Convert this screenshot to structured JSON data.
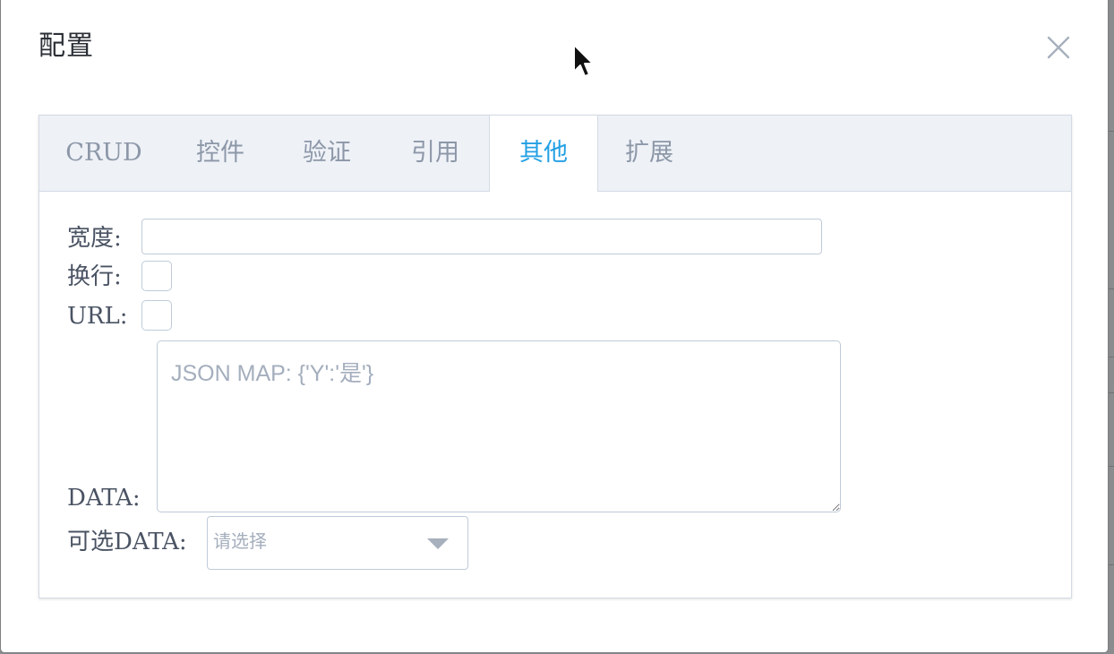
{
  "dialog": {
    "title": "配置"
  },
  "tabs": [
    {
      "label": "CRUD",
      "active": false
    },
    {
      "label": "控件",
      "active": false
    },
    {
      "label": "验证",
      "active": false
    },
    {
      "label": "引用",
      "active": false
    },
    {
      "label": "其他",
      "active": true
    },
    {
      "label": "扩展",
      "active": false
    }
  ],
  "form": {
    "width_label": "宽度:",
    "width_value": "",
    "wrap_label": "换行:",
    "url_label": "URL:",
    "data_label": "DATA:",
    "data_placeholder": "JSON MAP: {'Y':'是'}",
    "optional_data_label": "可选DATA:",
    "optional_data_placeholder": "请选择"
  },
  "colors": {
    "accent": "#23a0e4",
    "tab_text": "#8c97a8",
    "border": "#c0cbd9",
    "tab_bar_bg": "#eef1f6"
  },
  "icons": {
    "close": "close-icon",
    "dropdown": "caret-down-icon",
    "cursor": "mouse-pointer-icon",
    "resize": "resize-handle-icon"
  }
}
